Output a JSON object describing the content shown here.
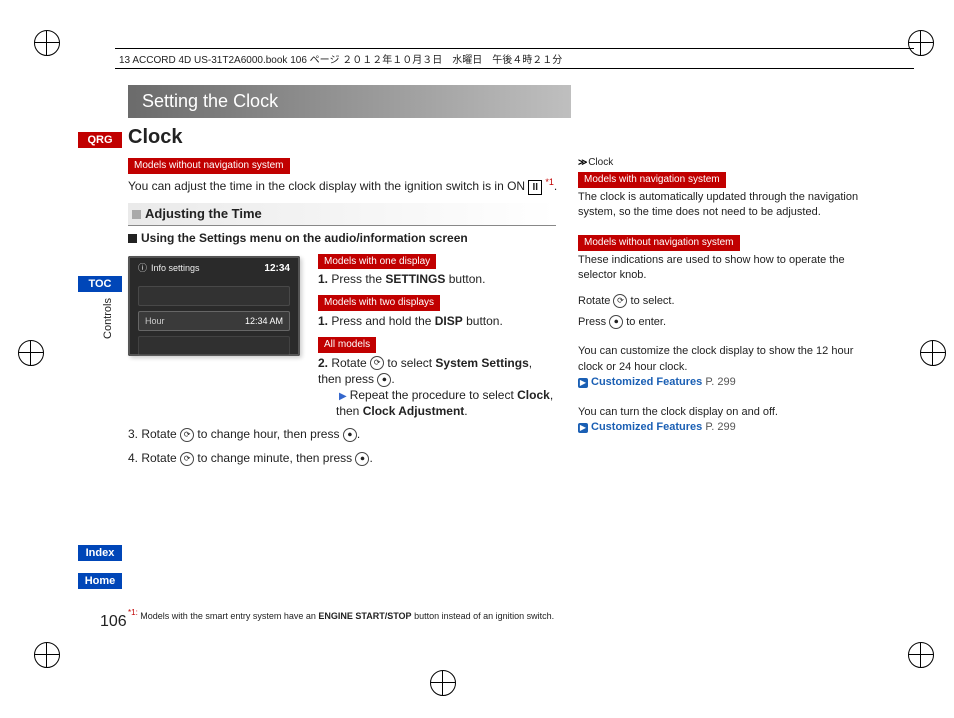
{
  "header_file": "13 ACCORD 4D US-31T2A6000.book  106 ページ  ２０１２年１０月３日　水曜日　午後４時２１分",
  "title_bar": "Setting the Clock",
  "section_title": "Clock",
  "nav": {
    "qrg": "QRG",
    "toc": "TOC",
    "index": "Index",
    "home": "Home"
  },
  "controls_label": "Controls",
  "tags": {
    "no_nav": "Models without navigation system",
    "with_nav": "Models with navigation system",
    "one_display": "Models with one display",
    "two_displays": "Models with two displays",
    "all_models": "All models"
  },
  "intro_text_a": "You can adjust the time in the clock display with the ignition switch is in ON ",
  "intro_on": "II",
  "intro_sup": "*1",
  "intro_text_b": ".",
  "sub_head": "Adjusting the Time",
  "instr_head": "Using the Settings menu on the audio/information screen",
  "screenshot": {
    "info_settings": "Info settings",
    "top_time": "12:34",
    "row2_label": "Hour",
    "row2_time": "12:34 AM"
  },
  "steps": {
    "s1a_pre": "Press the ",
    "s1a_b": "SETTINGS",
    "s1a_post": " button.",
    "s1b_pre": "Press and hold the ",
    "s1b_b": "DISP",
    "s1b_post": " button.",
    "s2_a": "Rotate ",
    "s2_b": " to select ",
    "s2_c": "System Settings",
    "s2_d": ", then press ",
    "s2_sub_a": "Repeat the procedure to select ",
    "s2_sub_b": "Clock",
    "s2_sub_c": ", then ",
    "s2_sub_d": "Clock Adjustment",
    "s2_sub_e": ".",
    "s3_a": "Rotate ",
    "s3_b": " to change hour, then press ",
    "s4_a": "Rotate ",
    "s4_b": " to change minute, then press "
  },
  "right": {
    "head": "Clock",
    "nav_text": "The clock is automatically updated through the navigation system, so the time does not need to be adjusted.",
    "no_nav_text": "These indications are used to show how to operate the selector knob.",
    "rotate_a": "Rotate ",
    "rotate_b": " to select.",
    "press_a": "Press ",
    "press_b": " to enter.",
    "cust_text": "You can customize the clock display to show the 12 hour clock or 24 hour clock.",
    "link_label": "Customized Features",
    "link_page": "P. 299",
    "onoff_text": "You can turn the clock display on and off."
  },
  "footnote_sup": "*1:",
  "footnote_a": " Models with the smart entry system have an ",
  "footnote_b": "ENGINE START/STOP",
  "footnote_c": " button instead of an ignition switch.",
  "page_num": "106"
}
